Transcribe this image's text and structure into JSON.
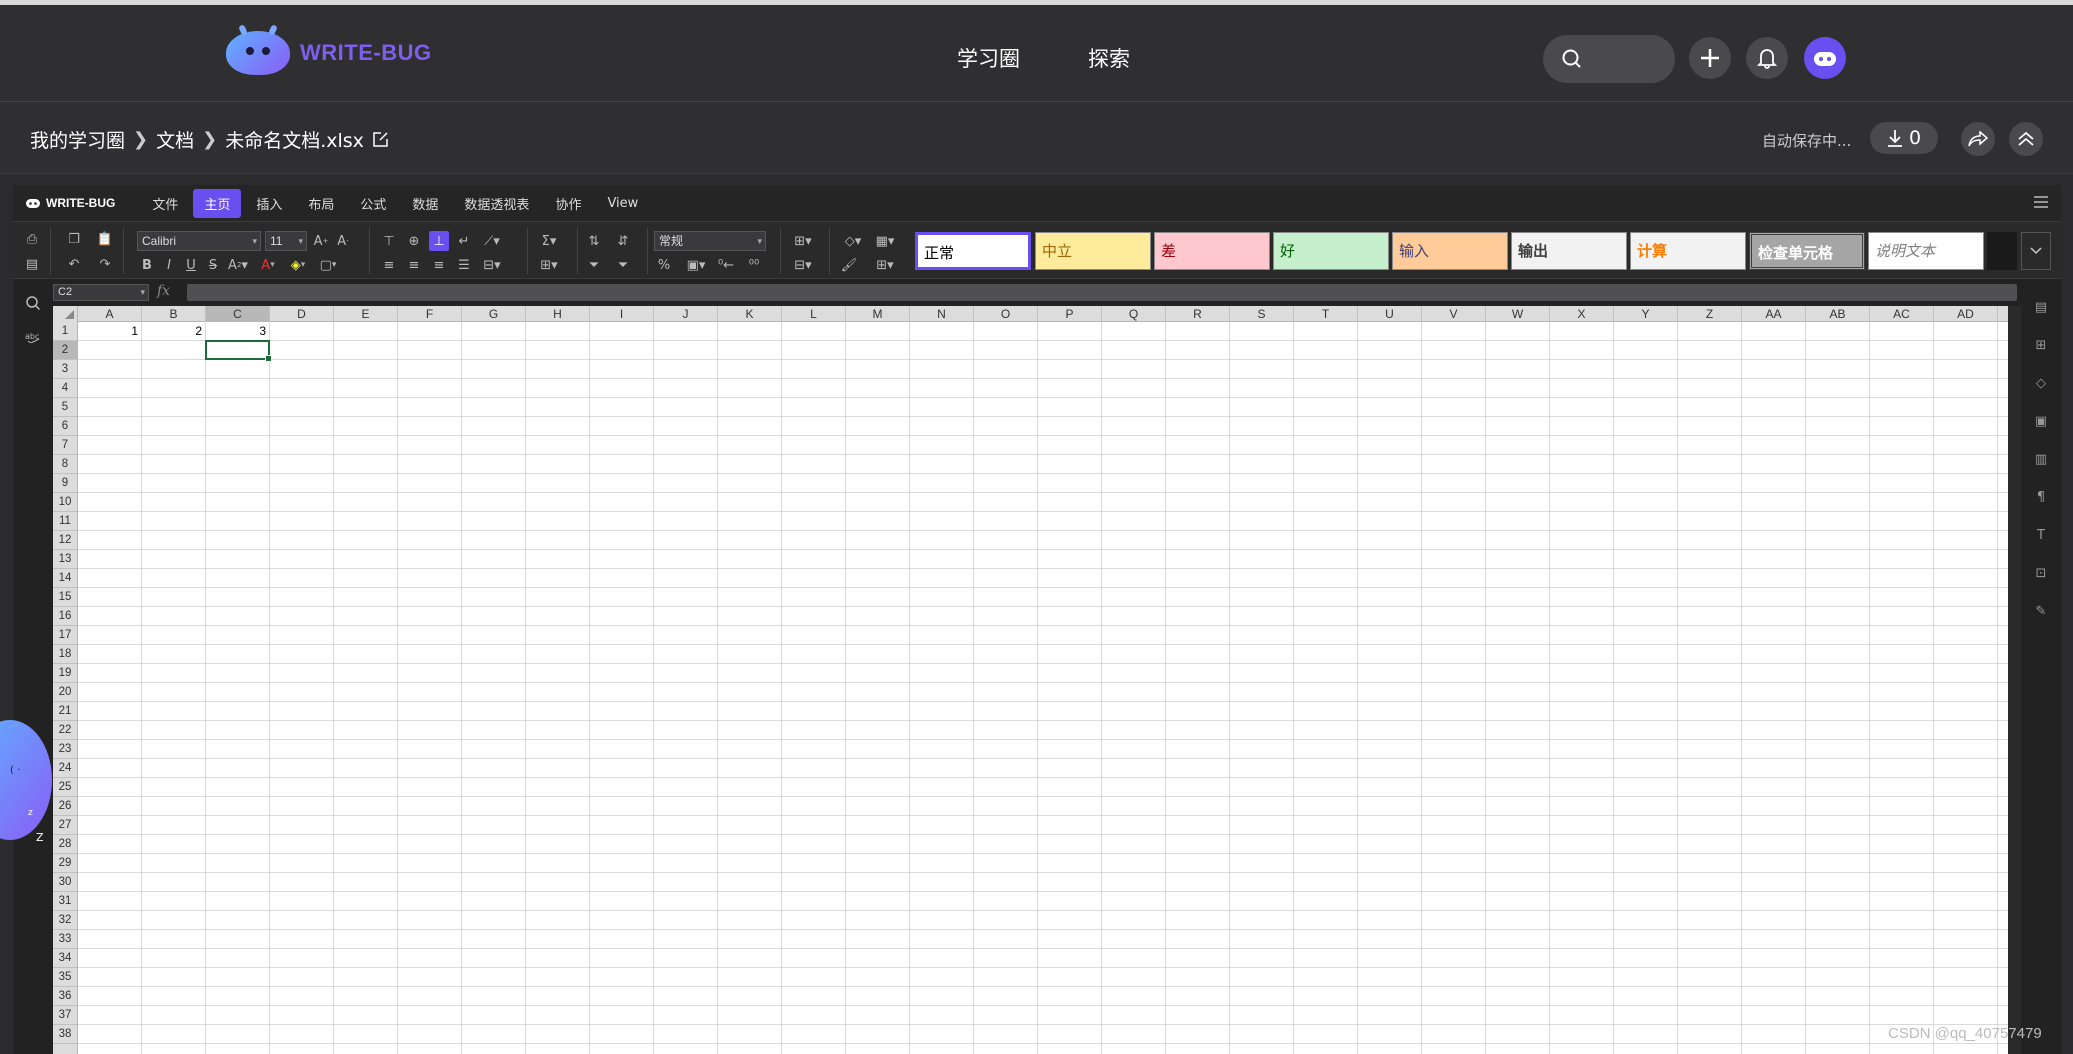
{
  "brand": {
    "name": "WRITE-BUG",
    "accent": "#6a4ff0"
  },
  "topnav": {
    "links": [
      "学习圈",
      "探索"
    ]
  },
  "docbar": {
    "breadcrumb": [
      "我的学习圈",
      "文档",
      "未命名文档.xlsx"
    ],
    "autosave": "自动保存中...",
    "download_count": "0"
  },
  "app": {
    "logo": "WRITE-BUG",
    "menu": [
      "文件",
      "主页",
      "插入",
      "布局",
      "公式",
      "数据",
      "数据透视表",
      "协作",
      "View"
    ],
    "active_menu": "主页",
    "font_name": "Calibri",
    "font_size": "11",
    "number_format": "常规",
    "cell_styles": [
      {
        "label": "正常",
        "bg": "#ffffff",
        "color": "#000000"
      },
      {
        "label": "中立",
        "bg": "#ffeb9c",
        "color": "#9c6500"
      },
      {
        "label": "差",
        "bg": "#ffc7ce",
        "color": "#9c0006"
      },
      {
        "label": "好",
        "bg": "#c6efce",
        "color": "#006100"
      },
      {
        "label": "输入",
        "bg": "#ffcc99",
        "color": "#3f3f76"
      },
      {
        "label": "输出",
        "bg": "#f2f2f2",
        "color": "#3f3f3f"
      },
      {
        "label": "计算",
        "bg": "#f2f2f2",
        "color": "#fa7d00"
      },
      {
        "label": "检查单元格",
        "bg": "#a5a5a5",
        "color": "#ffffff"
      },
      {
        "label": "说明文本",
        "bg": "#ffffff",
        "color": "#7f7f7f"
      }
    ]
  },
  "formula_bar": {
    "cell_ref": "C2",
    "fx": "fx",
    "formula": ""
  },
  "sheet": {
    "columns": [
      "A",
      "B",
      "C",
      "D",
      "E",
      "F",
      "G",
      "H",
      "I",
      "J",
      "K",
      "L",
      "M",
      "N",
      "O",
      "P",
      "Q",
      "R",
      "S",
      "T",
      "U",
      "V",
      "W",
      "X",
      "Y",
      "Z",
      "AA",
      "AB",
      "AC",
      "AD"
    ],
    "rows": [
      "1",
      "2",
      "3",
      "4",
      "5",
      "6",
      "7",
      "8",
      "9",
      "10",
      "11",
      "12",
      "13",
      "14",
      "15",
      "16",
      "17",
      "18",
      "19",
      "20",
      "21",
      "22",
      "23",
      "24",
      "25",
      "26",
      "27",
      "28",
      "29",
      "30",
      "31",
      "32",
      "33",
      "34",
      "35",
      "36",
      "37",
      "38"
    ],
    "selected_column": "C",
    "selected_row": "2",
    "cells": [
      {
        "ref": "A1",
        "value": "1"
      },
      {
        "ref": "B1",
        "value": "2"
      },
      {
        "ref": "C1",
        "value": "3"
      }
    ]
  },
  "watermark": "CSDN @qq_40757479"
}
